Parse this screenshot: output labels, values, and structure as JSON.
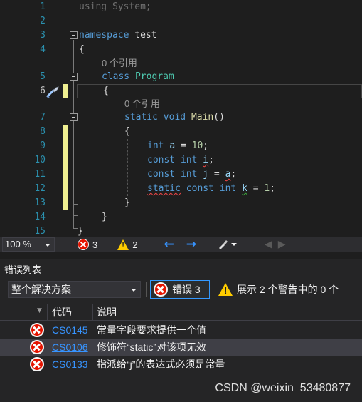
{
  "editor": {
    "line_numbers": [
      "1",
      "2",
      "3",
      "4",
      "5",
      "6",
      "7",
      "8",
      "9",
      "10",
      "11",
      "12",
      "13",
      "14",
      "15"
    ],
    "line1": {
      "kw": "using",
      "rest": " System;"
    },
    "line3": {
      "kw": "namespace",
      "rest": " test"
    },
    "line4": "{",
    "lens1": "0 个引用",
    "line5": {
      "kw": "class",
      "cls": "Program"
    },
    "line6": "{",
    "lens2": "0 个引用",
    "line7": {
      "kw1": "static",
      "kw2": "void",
      "fn": "Main",
      "rest": "()"
    },
    "line8": "{",
    "line9": {
      "kw": "int",
      "id": "a",
      "op": " = ",
      "num": "10",
      "end": ";"
    },
    "line10": {
      "kw1": "const",
      "kw2": "int",
      "id": "i",
      "end": ";"
    },
    "line11": {
      "kw1": "const",
      "kw2": "int",
      "id": "j",
      "op": " = ",
      "id2": "a",
      "end": ";"
    },
    "line12": {
      "kw1": "static",
      "kw2": "const",
      "kw3": "int",
      "id": "k",
      "op": " = ",
      "num": "1",
      "end": ";"
    },
    "line13": "}",
    "line14": "}",
    "line15": "}"
  },
  "status_strip": {
    "zoom": "100 %",
    "error_count": "3",
    "warning_count": "2",
    "back_icon": "←",
    "forward_icon": "→"
  },
  "error_list": {
    "title": "错误列表",
    "scope": "整个解决方案",
    "errors_button": "错误 3",
    "warnings_button": "展示 2 个警告中的 0 个",
    "col_code": "代码",
    "col_desc": "说明",
    "rows": [
      {
        "code": "CS0145",
        "desc": "常量字段要求提供一个值"
      },
      {
        "code": "CS0106",
        "desc": "修饰符“static”对该项无效"
      },
      {
        "code": "CS0133",
        "desc": "指派给“j”的表达式必须是常量"
      }
    ]
  },
  "watermark": "CSDN @weixin_53480877",
  "colors": {
    "keyword": "#569cd6",
    "class": "#4ec9b0",
    "method": "#dcdcaa",
    "number": "#b5cea8",
    "identifier": "#9cdcfe",
    "line_number": "#2b91af",
    "error": "#e51400",
    "warning": "#ffcc00",
    "link": "#3794ff"
  },
  "icons": [
    "error-icon",
    "warning-icon",
    "quick-action-screwdriver-icon",
    "filter-icon"
  ]
}
